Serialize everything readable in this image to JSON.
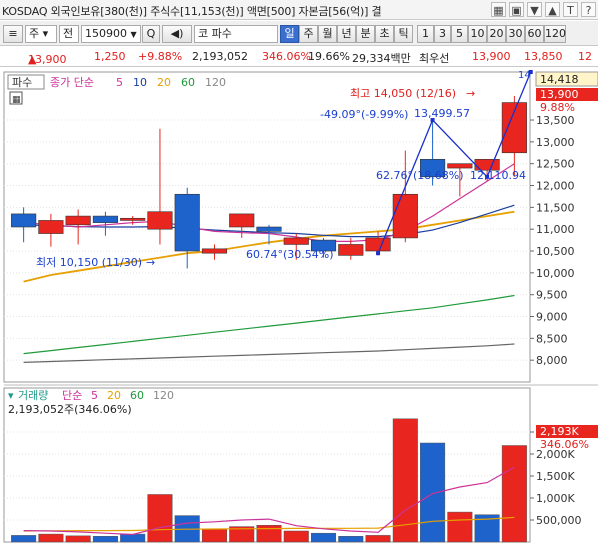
{
  "titlebar": {
    "title": "KOSDAQ 외국인보유[380(천)] 주식수[11,153(천)] 액면[500] 자본금[56(억)] 결",
    "icons": [
      "grid-icon",
      "snapshot-icon",
      "down-icon",
      "up-icon",
      "text-icon",
      "help-icon"
    ],
    "icon_glyphs": [
      "▦",
      "▣",
      "▼",
      "▲",
      "T",
      "?"
    ]
  },
  "toolbar": {
    "menu_glyph": "≡",
    "market_select": "주",
    "period_select": "전",
    "code_value": "150900",
    "code_dropdown": "▼",
    "search_glyph": "Q",
    "speaker_glyph": "◀)",
    "stock_name_prefix": "코",
    "stock_name": "파수",
    "period_buttons": [
      "일",
      "주",
      "월",
      "년",
      "분",
      "초",
      "틱"
    ],
    "active_period": "일",
    "interval_buttons": [
      "1",
      "3",
      "5",
      "10",
      "20",
      "30",
      "60",
      "120"
    ]
  },
  "inforow": {
    "price": "13,900",
    "arrow": "▲",
    "change": "1,250",
    "change_rate": "+9.88%",
    "volume": "2,193,052",
    "volume_ratio": "346.06%",
    "turnover": "19.66%",
    "amount": "29,334백만",
    "best_seller_label": "최우선",
    "ask": "13,900",
    "bid": "13,850",
    "more": "12"
  },
  "price_panel": {
    "name_tag": "파수",
    "legend_label": "종가 단순",
    "legend_periods": [
      "5",
      "10",
      "20",
      "60",
      "120"
    ],
    "annotations": {
      "high": "최고 14,050 (12/16)",
      "low": "최저 10,150 (11/30)",
      "fib1": "-49.09°(-9.99%)",
      "fib1_value": "13,499.57",
      "fib2": "62.76°(18.68%)",
      "fib2_value": "12,110.94",
      "fib3": "60.74°(30.54%)",
      "corner_value": "14"
    },
    "current_price_tag": "14,418",
    "close_tag": "13,900",
    "close_rate_tag": "9.88%"
  },
  "volume_panel": {
    "legend_label": "거래량",
    "legend_type": "단순",
    "legend_periods": [
      "5",
      "20",
      "60",
      "120"
    ],
    "volume_text": "2,193,052주(346.06%)",
    "volume_tag": "2,193K",
    "volume_rate_tag": "346.06%"
  },
  "colors": {
    "up": "#e8251e",
    "down": "#1e63cc",
    "ma5": "#cc3399",
    "ma10": "#1a3fa0",
    "ma20": "#e6a000",
    "ma60": "#1f9a3a",
    "ma120": "#666666",
    "trendline": "#1a2fcc"
  },
  "chart_data": [
    {
      "type": "candlestick",
      "title": "",
      "ylim": [
        7500,
        14600
      ],
      "y_ticks": [
        8000,
        8500,
        9000,
        9500,
        10000,
        10500,
        11000,
        11500,
        12000,
        12500,
        13000,
        13500
      ],
      "y_tick_labels": [
        "8,000",
        "8,500",
        "9,000",
        "9,500",
        "10,000",
        "10,500",
        "11,000",
        "11,500",
        "12,000",
        "12,500",
        "13,000",
        "13,500"
      ],
      "candles": [
        {
          "o": 11350,
          "h": 11500,
          "l": 10700,
          "c": 11050
        },
        {
          "o": 10900,
          "h": 11350,
          "l": 10600,
          "c": 11200
        },
        {
          "o": 11100,
          "h": 11450,
          "l": 10650,
          "c": 11300
        },
        {
          "o": 11300,
          "h": 11400,
          "l": 10850,
          "c": 11150
        },
        {
          "o": 11200,
          "h": 11300,
          "l": 11100,
          "c": 11250
        },
        {
          "o": 11000,
          "h": 13300,
          "l": 10650,
          "c": 11400
        },
        {
          "o": 11800,
          "h": 11950,
          "l": 10100,
          "c": 10500
        },
        {
          "o": 10450,
          "h": 10650,
          "l": 10300,
          "c": 10550
        },
        {
          "o": 11050,
          "h": 11350,
          "l": 10800,
          "c": 11350
        },
        {
          "o": 11050,
          "h": 11100,
          "l": 10650,
          "c": 10950
        },
        {
          "o": 10650,
          "h": 10900,
          "l": 10300,
          "c": 10800
        },
        {
          "o": 10750,
          "h": 10800,
          "l": 10350,
          "c": 10500
        },
        {
          "o": 10400,
          "h": 10800,
          "l": 10300,
          "c": 10650
        },
        {
          "o": 10500,
          "h": 10950,
          "l": 10400,
          "c": 10800
        },
        {
          "o": 10800,
          "h": 12800,
          "l": 10700,
          "c": 11800
        },
        {
          "o": 12600,
          "h": 13500,
          "l": 12000,
          "c": 12200
        },
        {
          "o": 12400,
          "h": 12500,
          "l": 11750,
          "c": 12500
        },
        {
          "o": 12350,
          "h": 12600,
          "l": 12100,
          "c": 12600
        },
        {
          "o": 12750,
          "h": 14050,
          "l": 12200,
          "c": 13900
        }
      ],
      "ma5": [
        11150,
        11100,
        11050,
        11100,
        11150,
        11180,
        11050,
        10950,
        10920,
        10900,
        10820,
        10720,
        10720,
        10760,
        10950,
        11300,
        11700,
        12100,
        12500
      ],
      "ma10": [
        11100,
        11080,
        11060,
        11050,
        11050,
        11060,
        11020,
        10980,
        10950,
        10920,
        10900,
        10860,
        10830,
        10830,
        10880,
        10980,
        11150,
        11350,
        11550
      ],
      "ma20": [
        9800,
        9950,
        10050,
        10150,
        10250,
        10350,
        10450,
        10500,
        10600,
        10700,
        10780,
        10850,
        10900,
        10950,
        11000,
        11100,
        11200,
        11300,
        11400
      ],
      "ma60": [
        8150,
        8220,
        8290,
        8360,
        8430,
        8500,
        8570,
        8640,
        8710,
        8780,
        8850,
        8920,
        8990,
        9060,
        9130,
        9200,
        9290,
        9380,
        9480
      ],
      "ma120": [
        7950,
        7970,
        7990,
        8010,
        8030,
        8050,
        8070,
        8090,
        8110,
        8130,
        8150,
        8170,
        8190,
        8210,
        8240,
        8270,
        8300,
        8330,
        8370
      ]
    },
    {
      "type": "bar",
      "title": "",
      "ylim": [
        0,
        3000000
      ],
      "y_ticks": [
        500000,
        1000000,
        1500000,
        2000000,
        2500000
      ],
      "y_tick_labels": [
        "500,000",
        "1,000K",
        "1,500K",
        "2,000K",
        "2,500K"
      ],
      "values": [
        150000,
        180000,
        140000,
        130000,
        180000,
        1080000,
        600000,
        300000,
        350000,
        380000,
        250000,
        200000,
        130000,
        150000,
        2800000,
        2250000,
        680000,
        620000,
        2193052
      ],
      "directions": [
        "down",
        "up",
        "up",
        "down",
        "down",
        "up",
        "down",
        "up",
        "up",
        "up",
        "up",
        "down",
        "down",
        "up",
        "up",
        "down",
        "up",
        "down",
        "up"
      ],
      "ma5": [
        260000,
        250000,
        230000,
        200000,
        170000,
        330000,
        430000,
        460000,
        500000,
        520000,
        370000,
        300000,
        250000,
        220000,
        720000,
        1100000,
        1250000,
        1350000,
        1700000
      ],
      "ma20": [
        250000,
        255000,
        260000,
        260000,
        262000,
        280000,
        290000,
        295000,
        300000,
        305000,
        310000,
        310000,
        312000,
        315000,
        390000,
        470000,
        500000,
        520000,
        560000
      ]
    }
  ]
}
